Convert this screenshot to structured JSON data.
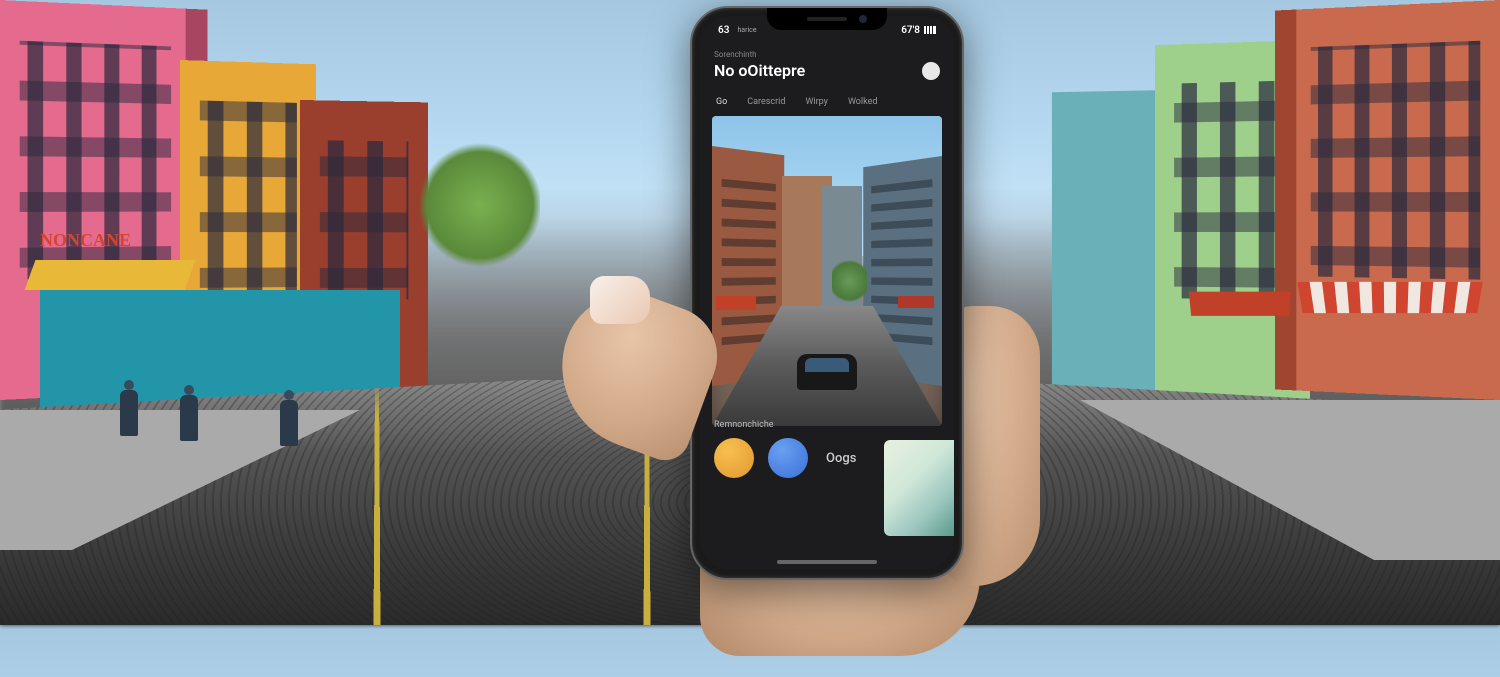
{
  "background": {
    "signage_left": "NONCANE"
  },
  "phone": {
    "status": {
      "time": "63",
      "label_left": "harice",
      "label_right": "67'8"
    },
    "header": {
      "subtitle": "Sorenchinth",
      "title": "No oOittepre"
    },
    "tabs": [
      {
        "label": "Go"
      },
      {
        "label": "Carescrid"
      },
      {
        "label": "Wirpy"
      },
      {
        "label": "Wolked"
      }
    ],
    "footer": {
      "label": "Remnonchiche",
      "action_label": "Oogs"
    },
    "colors": {
      "accent_orange": "#e8a030",
      "accent_blue": "#4a80e0",
      "status_dot": "#e8e8e8"
    }
  }
}
